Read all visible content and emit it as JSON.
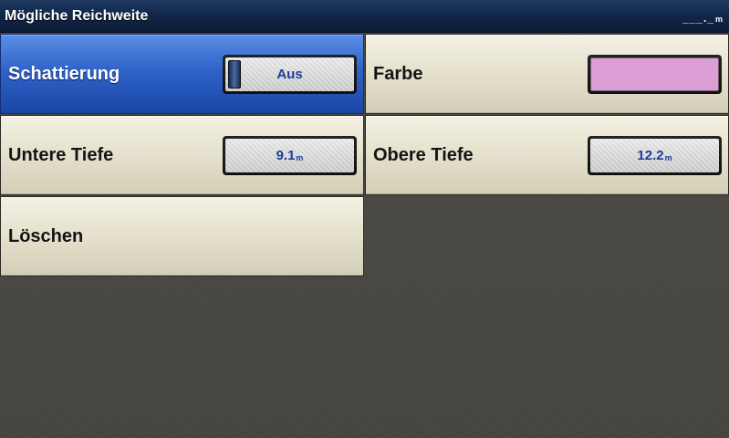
{
  "header": {
    "title": "Mögliche Reichweite",
    "status_value": "___._",
    "status_unit": "m"
  },
  "menu": {
    "shading": {
      "label": "Schattierung",
      "value": "Aus",
      "selected": true
    },
    "color": {
      "label": "Farbe",
      "swatch_color": "#dc9fd5"
    },
    "lower_depth": {
      "label": "Untere Tiefe",
      "value": "9.1",
      "unit": "m"
    },
    "upper_depth": {
      "label": "Obere Tiefe",
      "value": "12.2",
      "unit": "m"
    },
    "delete": {
      "label": "Löschen"
    }
  },
  "colors": {
    "selected_tile": "#2f63c8",
    "value_text": "#1d3d9a",
    "titlebar": "#12284a"
  }
}
